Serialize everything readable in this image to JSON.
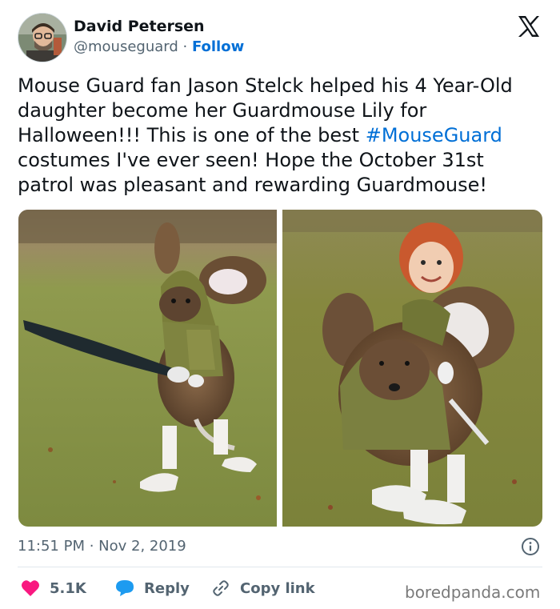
{
  "author": {
    "name": "David Petersen",
    "handle": "@mouseguard",
    "separator": " · ",
    "follow_label": "Follow"
  },
  "tweet": {
    "text_before": "Mouse Guard fan Jason Stelck helped his 4 Year-Old daughter become her Guardmouse Lily for Halloween!!! This is one of the best ",
    "hashtag": "#MouseGuard",
    "text_after": " costumes I've ever seen! Hope the October 31st patrol was pleasant and rewarding Guardmouse!"
  },
  "meta": {
    "time": "11:51 PM",
    "separator": " · ",
    "date": "Nov 2, 2019"
  },
  "actions": {
    "like_count": "5.1K",
    "reply_label": "Reply",
    "copy_label": "Copy link"
  },
  "watermark": "boredpanda.com",
  "icons": {
    "platform": "x-logo-icon",
    "info": "info-icon",
    "like": "heart-icon",
    "reply": "speech-bubble-icon",
    "copy": "link-icon"
  },
  "colors": {
    "link": "#006fd6",
    "like": "#f91880",
    "reply": "#1d9bf0",
    "muted": "#536471",
    "text": "#0f1419"
  }
}
